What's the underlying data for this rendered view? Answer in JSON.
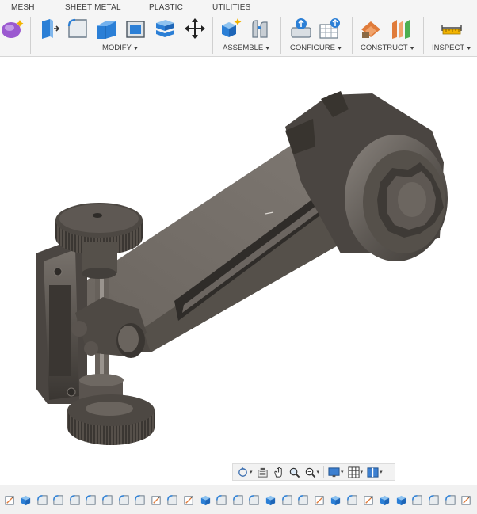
{
  "toolbar": {
    "tabs": [
      {
        "label": "MESH"
      },
      {
        "label": "SHEET METAL"
      },
      {
        "label": "PLASTIC"
      },
      {
        "label": "UTILITIES"
      }
    ],
    "groups": [
      {
        "label": "MODIFY"
      },
      {
        "label": "ASSEMBLE"
      },
      {
        "label": "CONFIGURE"
      },
      {
        "label": "CONSTRUCT"
      },
      {
        "label": "INSPECT"
      }
    ],
    "tools": [
      {
        "icon": "create-form-icon"
      },
      {
        "icon": "press-pull-icon"
      },
      {
        "icon": "fillet-icon"
      },
      {
        "icon": "chamfer-icon"
      },
      {
        "icon": "shell-icon"
      },
      {
        "icon": "combine-icon"
      },
      {
        "icon": "move-copy-icon"
      },
      {
        "icon": "new-component-icon"
      },
      {
        "icon": "joint-icon"
      },
      {
        "icon": "configure-icon"
      },
      {
        "icon": "configuration-table-icon"
      },
      {
        "icon": "offset-plane-icon"
      },
      {
        "icon": "midplane-icon"
      },
      {
        "icon": "measure-icon"
      }
    ]
  },
  "navbar": {
    "items": [
      {
        "icon": "orbit-icon",
        "caret": "▾"
      },
      {
        "icon": "look-at-icon",
        "caret": ""
      },
      {
        "icon": "pan-icon",
        "caret": ""
      },
      {
        "icon": "zoom-icon",
        "caret": ""
      },
      {
        "icon": "fit-icon",
        "caret": "▾"
      },
      {
        "icon": "display-settings-icon",
        "caret": "▾"
      },
      {
        "icon": "grid-snap-icon",
        "caret": "▾"
      },
      {
        "icon": "viewports-icon",
        "caret": "▾"
      }
    ]
  },
  "timeline": {
    "items": [
      "sketch",
      "body",
      "fillet",
      "fillet",
      "fillet",
      "fillet",
      "fillet",
      "fillet",
      "fillet",
      "sketch",
      "fillet",
      "sketch",
      "body",
      "fillet",
      "fillet",
      "fillet",
      "body",
      "fillet",
      "fillet",
      "sketch",
      "body",
      "fillet",
      "sketch",
      "body",
      "body",
      "fillet",
      "fillet",
      "fillet",
      "sketch"
    ]
  },
  "colors": {
    "accent_blue": "#1a7fd4",
    "toolbar_bg": "#f5f5f5",
    "model_metal": "#5f5a55"
  }
}
